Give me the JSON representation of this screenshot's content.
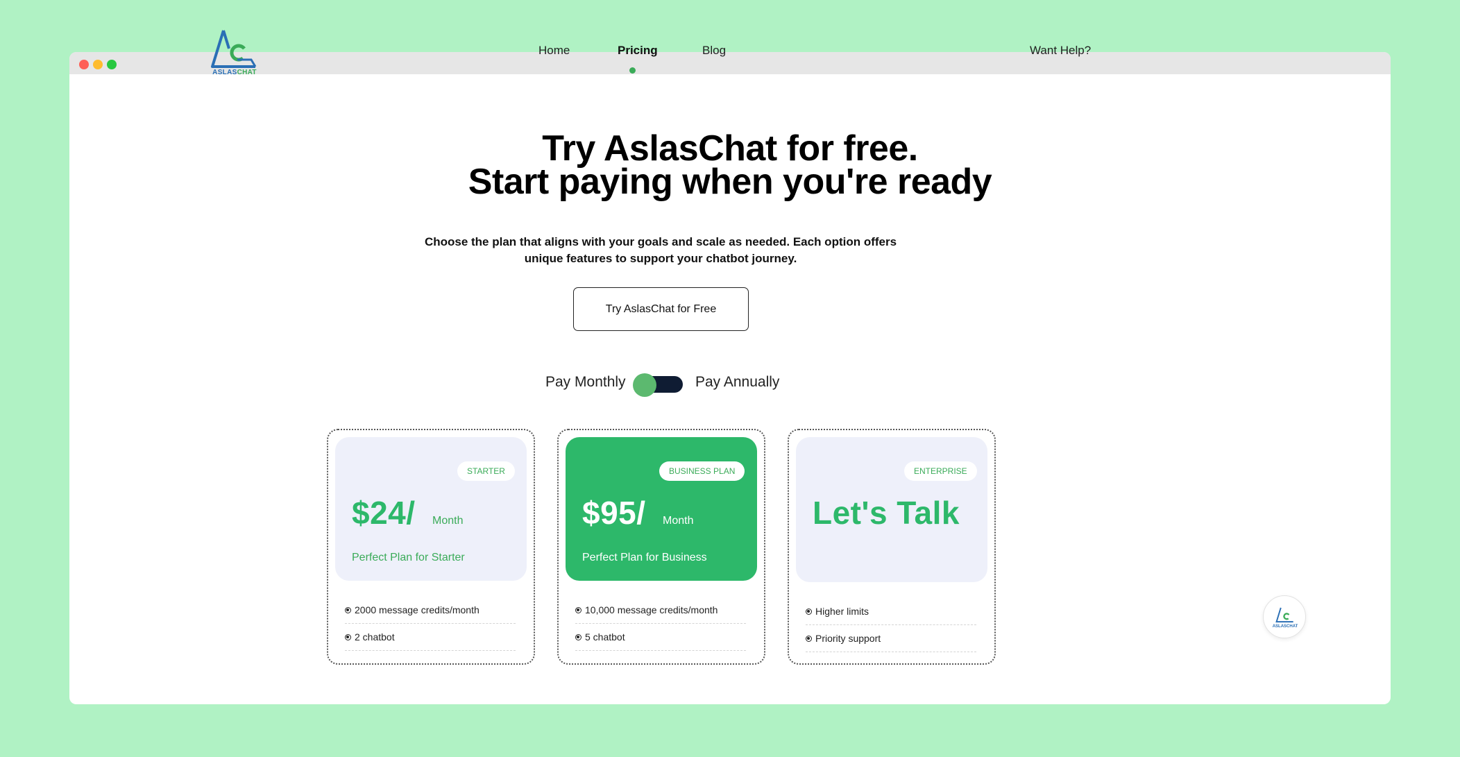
{
  "brand": {
    "logo_text_part1": "ASLAS",
    "logo_text_part2": "CHAT",
    "colors": {
      "blue": "#2a6fb5",
      "green": "#3aab58",
      "accent": "#2db86a",
      "dark": "#0f1c33"
    }
  },
  "nav": {
    "items": [
      {
        "label": "Home",
        "active": false
      },
      {
        "label": "Pricing",
        "active": true
      },
      {
        "label": "Blog",
        "active": false
      }
    ],
    "help": "Want Help?"
  },
  "hero": {
    "title_line1": "Try AslasChat for free.",
    "title_line2": "Start paying when you're ready",
    "subtitle_line1": "Choose the plan that aligns with your goals and scale as needed. Each option offers",
    "subtitle_line2": "unique features to support your chatbot journey.",
    "cta": "Try AslasChat for Free"
  },
  "billing_toggle": {
    "left_label": "Pay Monthly",
    "right_label": "Pay Annually",
    "selected": "Pay Monthly"
  },
  "plans": [
    {
      "badge": "STARTER",
      "price": "$24/",
      "period": "Month",
      "description": "Perfect Plan for Starter",
      "features": [
        "2000 message credits/month",
        "2 chatbot"
      ]
    },
    {
      "badge": "BUSINESS PLAN",
      "price": "$95/",
      "period": "Month",
      "description": "Perfect Plan for Business",
      "features": [
        "10,000 message credits/month",
        "5 chatbot"
      ]
    },
    {
      "badge": "ENTERPRISE",
      "price": "Let's Talk",
      "features": [
        "Higher limits",
        "Priority support"
      ]
    }
  ],
  "chat_widget": {
    "label": "ASLASCHAT",
    "icon": "chat-logo-icon"
  }
}
